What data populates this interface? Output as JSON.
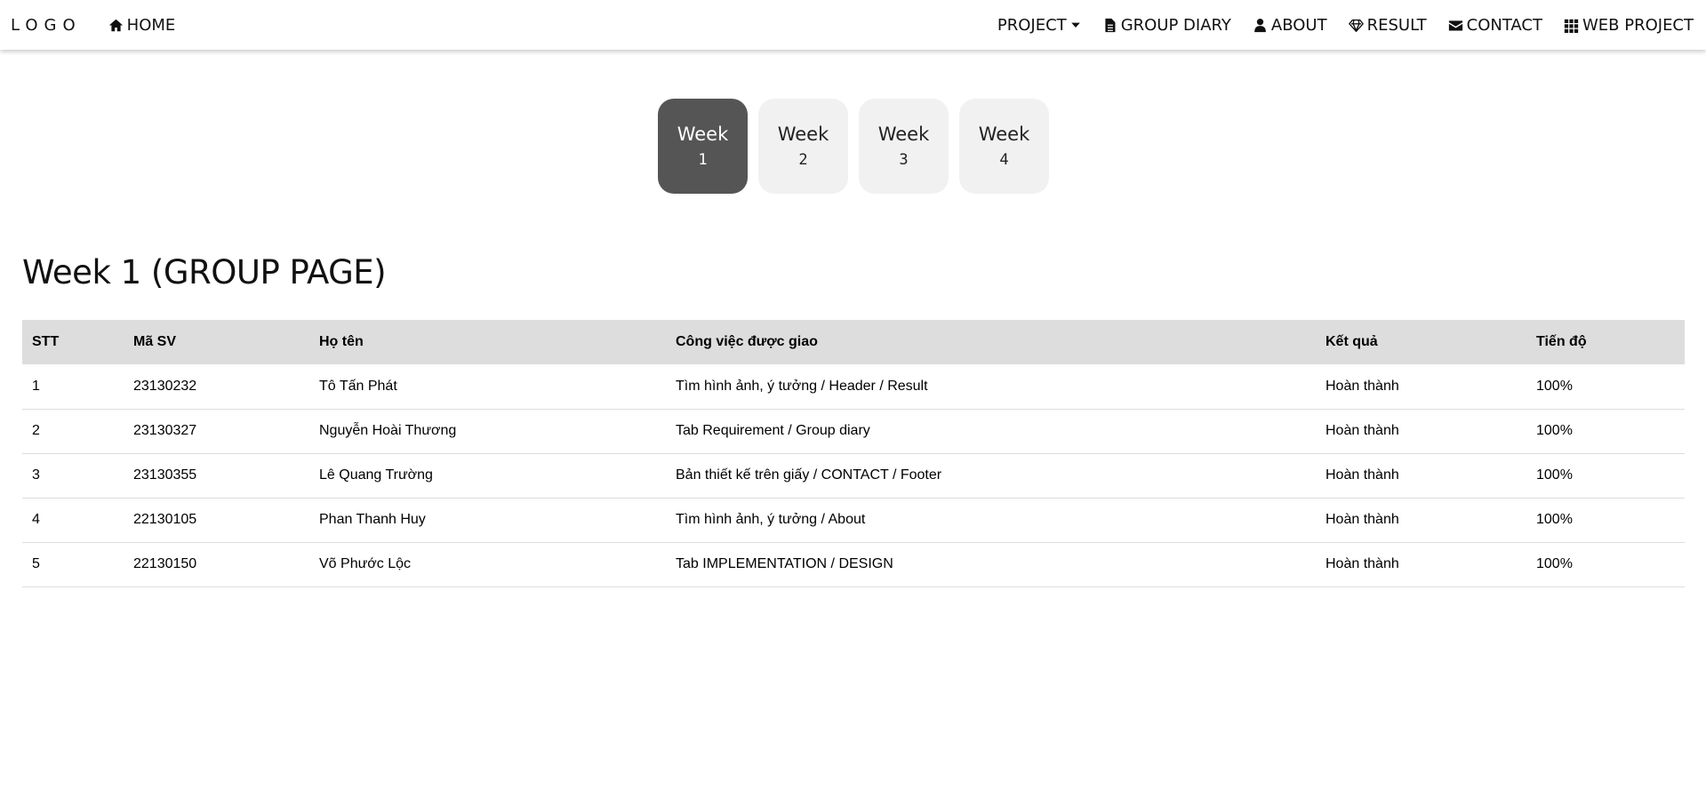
{
  "nav": {
    "logo": "LOGO",
    "home": "HOME",
    "project": "PROJECT",
    "group_diary": "GROUP DIARY",
    "about": "ABOUT",
    "result": "RESULT",
    "contact": "CONTACT",
    "web_project": "WEB PROJECT",
    "icons": [
      "home-icon",
      "caret-down-icon",
      "file-icon",
      "user-icon",
      "diamond-icon",
      "envelope-icon",
      "grid-icon"
    ]
  },
  "weeks": [
    {
      "label": "Week",
      "number": "1",
      "active": true
    },
    {
      "label": "Week",
      "number": "2",
      "active": false
    },
    {
      "label": "Week",
      "number": "3",
      "active": false
    },
    {
      "label": "Week",
      "number": "4",
      "active": false
    }
  ],
  "page_title": "Week 1 (GROUP PAGE)",
  "table": {
    "headers": [
      "STT",
      "Mã SV",
      "Họ tên",
      "Công việc được giao",
      "Kết quả",
      "Tiến độ"
    ],
    "rows": [
      [
        "1",
        "23130232",
        "Tô Tấn Phát",
        "Tìm hình ảnh, ý tưởng / Header / Result",
        "Hoàn thành",
        "100%"
      ],
      [
        "2",
        "23130327",
        "Nguyễn Hoài Thương",
        "Tab Requirement / Group diary",
        "Hoàn thành",
        "100%"
      ],
      [
        "3",
        "23130355",
        "Lê Quang Trường",
        "Bản thiết kế trên giấy / CONTACT / Footer",
        "Hoàn thành",
        "100%"
      ],
      [
        "4",
        "22130105",
        "Phan Thanh Huy",
        "Tìm hình ảnh, ý tưởng / About",
        "Hoàn thành",
        "100%"
      ],
      [
        "5",
        "22130150",
        "Võ Phước Lộc",
        "Tab IMPLEMENTATION / DESIGN",
        "Hoàn thành",
        "100%"
      ]
    ]
  },
  "colors": {
    "active_tab": "#555555",
    "inactive_tab": "#f1f1f1",
    "table_header": "#dddddd"
  }
}
